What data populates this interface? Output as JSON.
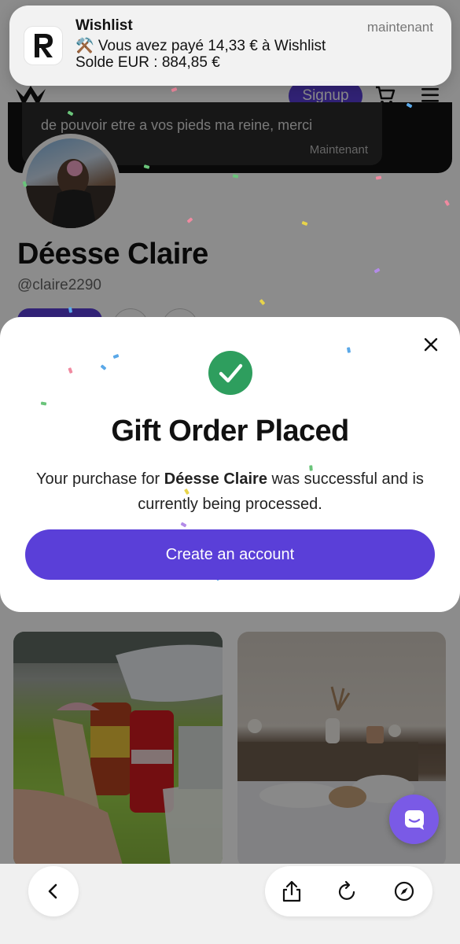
{
  "notification": {
    "app_name": "Wishlist",
    "time": "maintenant",
    "line1": "⚒️ Vous avez payé 14,33 € à Wishlist",
    "line2": "Solde EUR : 884,85 €"
  },
  "site_header": {
    "signup_label": "Signup"
  },
  "toast": {
    "message": "de pouvoir etre a vos pieds ma reine, merci",
    "time": "Maintenant"
  },
  "profile": {
    "name": "Déesse Claire",
    "handle": "@claire2290"
  },
  "modal": {
    "title": "Gift Order Placed",
    "desc_prefix": "Your purchase for ",
    "desc_name": "Déesse Claire",
    "desc_suffix": " was successful and is currently being processed.",
    "cta_label": "Create an account"
  },
  "colors": {
    "accent": "#5a3fd8",
    "success": "#2e9e5e",
    "chat": "#7a5ae6"
  },
  "icons": [
    "r-logo-icon",
    "crown-logo-icon",
    "cart-icon",
    "menu-icon",
    "close-icon",
    "check-icon",
    "chat-icon",
    "chevron-left-icon",
    "share-icon",
    "reload-icon",
    "compass-icon"
  ]
}
